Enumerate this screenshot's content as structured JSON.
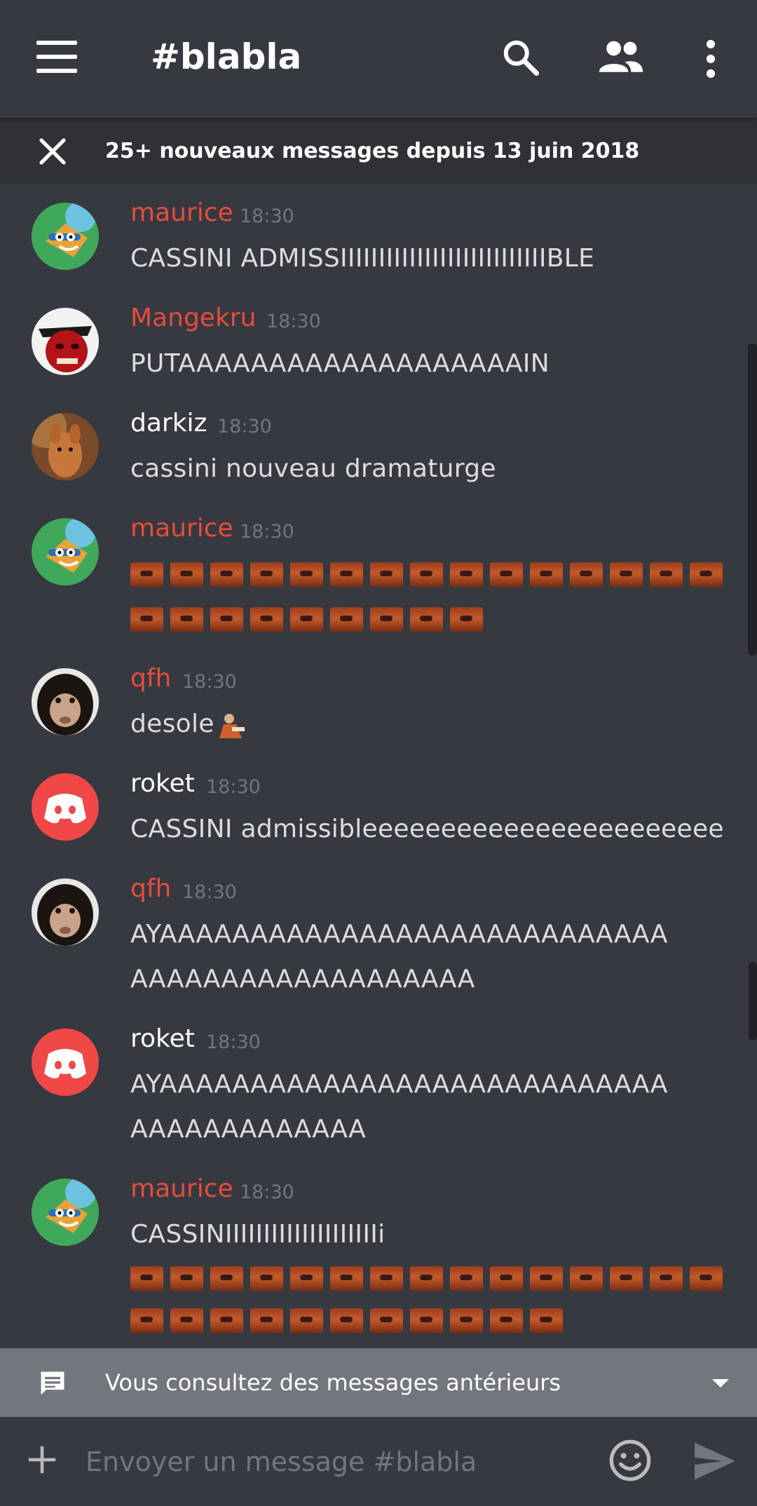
{
  "colors": {
    "background": "#36393f",
    "username_red": "#e74c3c",
    "username_white": "#ffffff",
    "timestamp": "#72767d",
    "discord_avatar": "#f04747",
    "older_bar": "#72767d"
  },
  "header": {
    "channel_name": "#blabla",
    "icons": [
      "menu-icon",
      "search-icon",
      "members-icon",
      "more-vertical-icon"
    ]
  },
  "new_messages_bar": {
    "text": "25+ nouveaux messages depuis 13 juin 2018"
  },
  "messages": [
    {
      "author": "maurice",
      "time": "18:30",
      "text": "CASSINI ADMISSIIIIIIIIIIIIIIIIIIIIIIIIIIIBLE",
      "name_color": "red",
      "avatar": "cartoon-fox-avatar"
    },
    {
      "author": "Mangekru",
      "time": "18:30",
      "text": "PUTAAAAAAAAAAAAAAAAAAAIN",
      "name_color": "red",
      "avatar": "red-face-avatar"
    },
    {
      "author": "darkiz",
      "time": "18:30",
      "text": "cassini nouveau dramaturge",
      "name_color": "white",
      "avatar": "kangaroo-avatar"
    },
    {
      "author": "maurice",
      "time": "18:30",
      "emoji_rows": [
        15,
        9
      ],
      "name_color": "red",
      "avatar": "cartoon-fox-avatar"
    },
    {
      "author": "qfh",
      "time": "18:30",
      "text": "desole",
      "name_color": "red",
      "avatar": "chimp-avatar"
    },
    {
      "author": "roket",
      "time": "18:30",
      "text": "CASSINI admissibleeeeeeeeeeeeeeeeeeeeeee",
      "name_color": "white",
      "avatar": "discord-default-avatar"
    },
    {
      "author": "qfh",
      "time": "18:30",
      "text_lines": [
        "AYAAAAAAAAAAAAAAAAAAAAAAAAAAAA",
        "AAAAAAAAAAAAAAAAAAA"
      ],
      "name_color": "red",
      "avatar": "chimp-avatar"
    },
    {
      "author": "roket",
      "time": "18:30",
      "text_lines": [
        "AYAAAAAAAAAAAAAAAAAAAAAAAAAAAA",
        "AAAAAAAAAAAAA"
      ],
      "name_color": "white",
      "avatar": "discord-default-avatar"
    },
    {
      "author": "maurice",
      "time": "18:30",
      "text": "CASSINIIIIIIIIIIIIIIIIIIIIi",
      "emoji_rows": [
        15,
        11
      ],
      "name_color": "red",
      "avatar": "cartoon-fox-avatar"
    }
  ],
  "older_messages_bar": {
    "text": "Vous consultez des messages antérieurs"
  },
  "composer": {
    "placeholder": "Envoyer un message #blabla"
  }
}
